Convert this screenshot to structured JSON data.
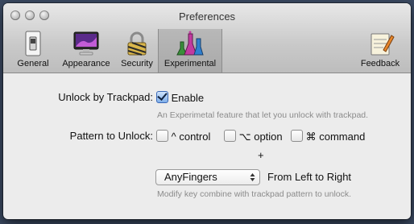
{
  "window": {
    "title": "Preferences"
  },
  "toolbar": {
    "items": [
      {
        "label": "General",
        "icon": "switch-icon"
      },
      {
        "label": "Appearance",
        "icon": "display-icon"
      },
      {
        "label": "Security",
        "icon": "padlock-icon"
      },
      {
        "label": "Experimental",
        "icon": "flasks-icon",
        "selected": true
      },
      {
        "label": "Feedback",
        "icon": "feedback-note-icon"
      }
    ]
  },
  "main": {
    "unlock_label": "Unlock by Trackpad:",
    "enable_label": "Enable",
    "enable_checked": true,
    "enable_hint": "An Experimetal feature that let you unlock with trackpad.",
    "pattern_label": "Pattern to Unlock:",
    "modifiers": [
      {
        "label": "^ control",
        "checked": false
      },
      {
        "label": "⌥ option",
        "checked": false
      },
      {
        "label": "⌘ command",
        "checked": false
      }
    ],
    "plus": "+",
    "gesture_value": "AnyFingers",
    "direction": "From Left to Right",
    "gesture_hint": "Modify key combine with trackpad pattern to unlock."
  },
  "colors": {
    "accent": "#3a68b6",
    "background": "#3b4a62"
  }
}
